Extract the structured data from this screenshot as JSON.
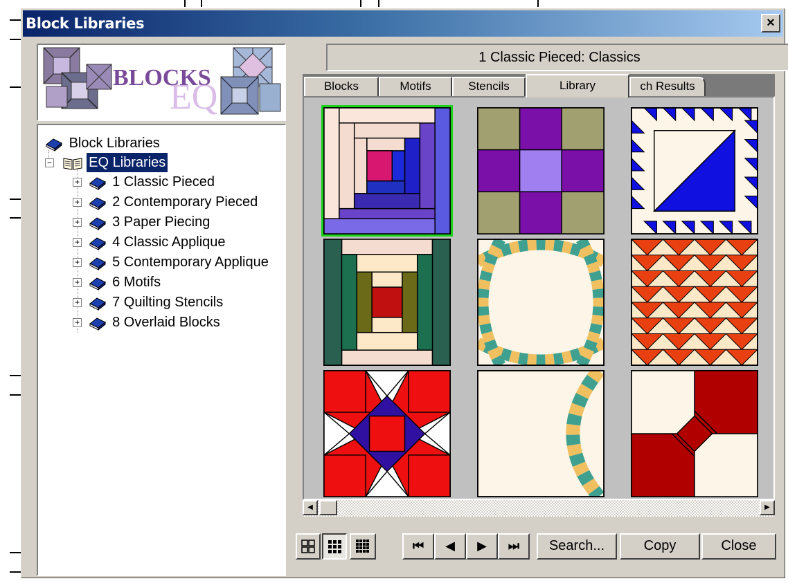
{
  "window": {
    "title": "Block Libraries",
    "close_glyph": "×"
  },
  "logo": {
    "text": "BLOCKS",
    "letters": "EQ"
  },
  "tree": {
    "root": {
      "label": "Block Libraries",
      "icon": "book-icon"
    },
    "node": {
      "label": "EQ Libraries",
      "icon": "open-book-icon",
      "expander": "−"
    },
    "items": [
      {
        "label": "1 Classic Pieced",
        "expander": "+"
      },
      {
        "label": "2 Contemporary Pieced",
        "expander": "+"
      },
      {
        "label": "3 Paper Piecing",
        "expander": "+"
      },
      {
        "label": "4 Classic Applique",
        "expander": "+"
      },
      {
        "label": "5 Contemporary Applique",
        "expander": "+"
      },
      {
        "label": "6 Motifs",
        "expander": "+"
      },
      {
        "label": "7 Quilting Stencils",
        "expander": "+"
      },
      {
        "label": "8 Overlaid Blocks",
        "expander": "+"
      }
    ]
  },
  "header": {
    "text": "1 Classic Pieced:   Classics"
  },
  "tabs": [
    {
      "label": "Blocks"
    },
    {
      "label": "Motifs"
    },
    {
      "label": "Stencils"
    },
    {
      "label": "Library",
      "active": true
    },
    {
      "label": "ch Results"
    }
  ],
  "blocks": [
    {
      "name": "log-cabin-purple",
      "selected": true
    },
    {
      "name": "nine-patch-purple"
    },
    {
      "name": "sawtooth-triangle-blue"
    },
    {
      "name": "log-cabin-green"
    },
    {
      "name": "double-wedding-ring"
    },
    {
      "name": "flying-geese-orange"
    },
    {
      "name": "ohio-star-red"
    },
    {
      "name": "wedding-ring-arc"
    },
    {
      "name": "red-corner-block"
    }
  ],
  "toolbar": {
    "view_buttons": [
      "large-grid-icon",
      "medium-grid-icon",
      "small-grid-icon"
    ],
    "nav": {
      "first": "⏮",
      "prev": "◀",
      "next": "▶",
      "last": "⏭"
    },
    "search_label": "Search...",
    "copy_label": "Copy",
    "close_label": "Close"
  },
  "colors": {
    "title_active": "#0a246a",
    "selection_green": "#1ad41a",
    "dialog_face": "#d4d0c8"
  }
}
